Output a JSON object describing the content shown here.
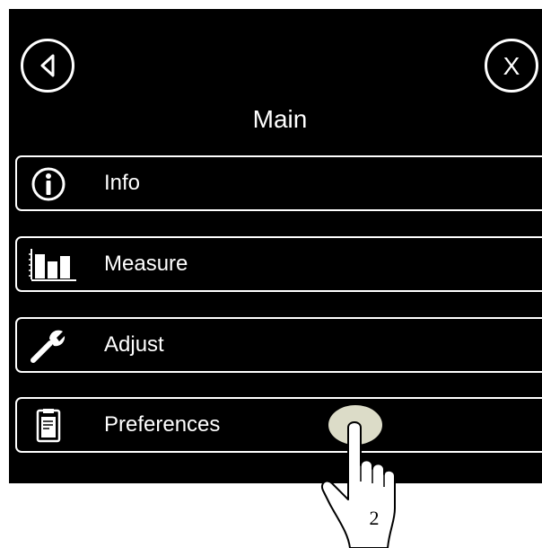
{
  "header": {
    "title": "Main",
    "back_icon": "back-triangle-icon",
    "close_label": "X"
  },
  "menu": {
    "items": [
      {
        "label": "Info",
        "icon": "info-icon"
      },
      {
        "label": "Measure",
        "icon": "bar-chart-icon"
      },
      {
        "label": "Adjust",
        "icon": "wrench-icon"
      },
      {
        "label": "Preferences",
        "icon": "clipboard-icon"
      }
    ]
  },
  "annotation": {
    "step_number": "2",
    "icon": "pointing-hand-icon"
  },
  "colors": {
    "screen_background": "#000000",
    "foreground": "#ffffff",
    "touch_highlight": "#dcdcc8"
  }
}
